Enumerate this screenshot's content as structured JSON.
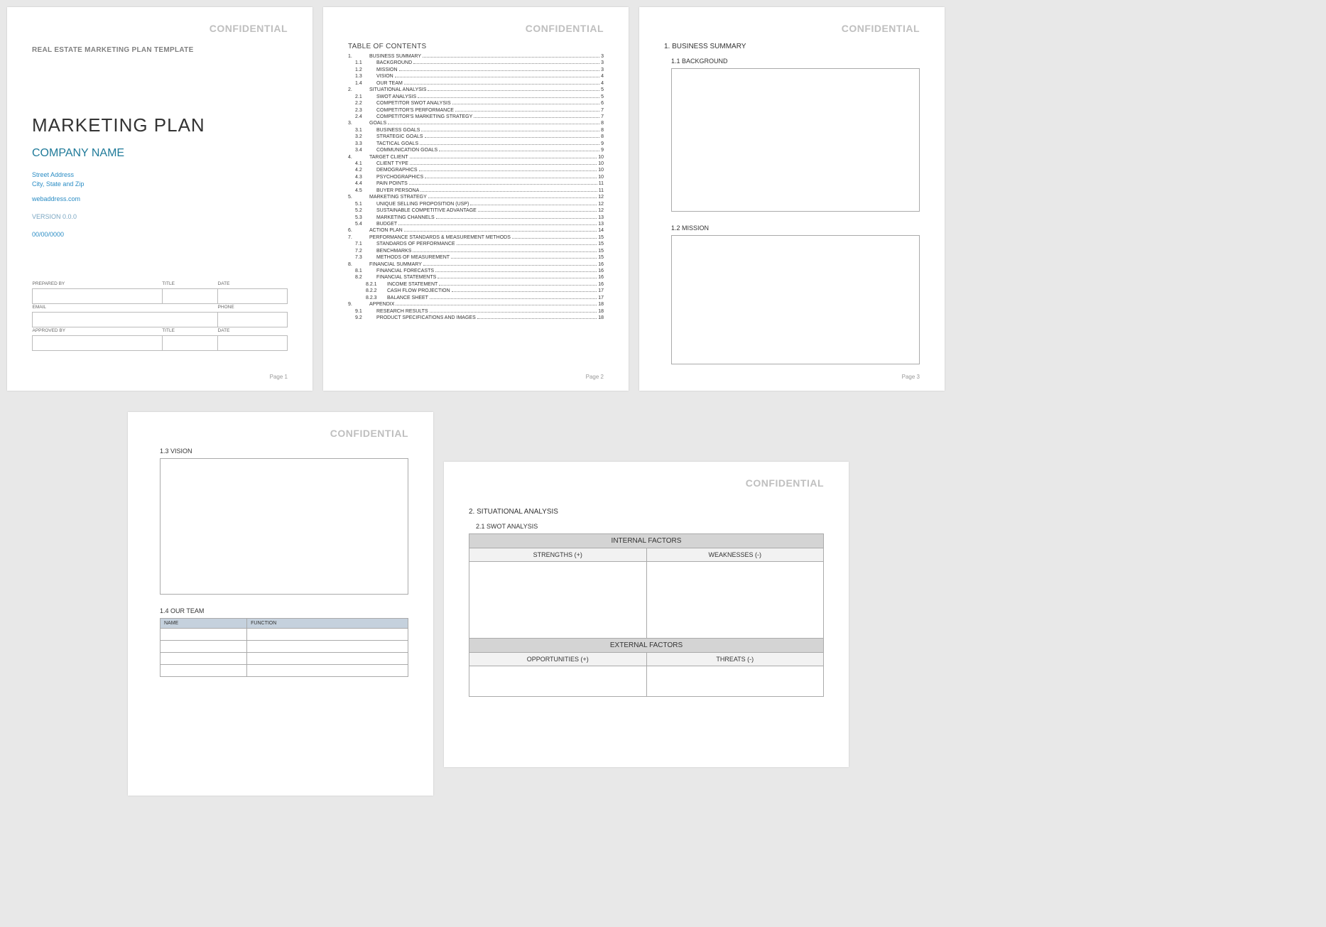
{
  "confidential": "CONFIDENTIAL",
  "page1": {
    "templateTitle": "REAL ESTATE MARKETING PLAN TEMPLATE",
    "title": "MARKETING PLAN",
    "company": "COMPANY NAME",
    "street": "Street Address",
    "cityState": "City, State and Zip",
    "web": "webaddress.com",
    "version": "VERSION 0.0.0",
    "date": "00/00/0000",
    "labels": {
      "preparedBy": "PREPARED BY",
      "title": "TITLE",
      "date": "DATE",
      "email": "EMAIL",
      "phone": "PHONE",
      "approvedBy": "APPROVED BY"
    },
    "pageNum": "Page 1"
  },
  "page2": {
    "tocHead": "TABLE OF CONTENTS",
    "toc": [
      {
        "n": "1.",
        "t": "BUSINESS SUMMARY",
        "p": "3",
        "lvl": 0
      },
      {
        "n": "1.1",
        "t": "BACKGROUND",
        "p": "3",
        "lvl": 1
      },
      {
        "n": "1.2",
        "t": "MISSION",
        "p": "3",
        "lvl": 1
      },
      {
        "n": "1.3",
        "t": "VISION",
        "p": "4",
        "lvl": 1
      },
      {
        "n": "1.4",
        "t": "OUR TEAM",
        "p": "4",
        "lvl": 1
      },
      {
        "n": "2.",
        "t": "SITUATIONAL ANALYSIS",
        "p": "5",
        "lvl": 0
      },
      {
        "n": "2.1",
        "t": "SWOT ANALYSIS",
        "p": "5",
        "lvl": 1
      },
      {
        "n": "2.2",
        "t": "COMPETITOR SWOT ANALYSIS",
        "p": "6",
        "lvl": 1
      },
      {
        "n": "2.3",
        "t": "COMPETITOR'S PERFORMANCE",
        "p": "7",
        "lvl": 1
      },
      {
        "n": "2.4",
        "t": "COMPETITOR'S MARKETING STRATEGY",
        "p": "7",
        "lvl": 1
      },
      {
        "n": "3.",
        "t": "GOALS",
        "p": "8",
        "lvl": 0
      },
      {
        "n": "3.1",
        "t": "BUSINESS GOALS",
        "p": "8",
        "lvl": 1
      },
      {
        "n": "3.2",
        "t": "STRATEGIC GOALS",
        "p": "8",
        "lvl": 1
      },
      {
        "n": "3.3",
        "t": "TACTICAL GOALS",
        "p": "9",
        "lvl": 1
      },
      {
        "n": "3.4",
        "t": "COMMUNICATION GOALS",
        "p": "9",
        "lvl": 1
      },
      {
        "n": "4.",
        "t": "TARGET CLIENT",
        "p": "10",
        "lvl": 0
      },
      {
        "n": "4.1",
        "t": "CLIENT TYPE",
        "p": "10",
        "lvl": 1
      },
      {
        "n": "4.2",
        "t": "DEMOGRAPHICS",
        "p": "10",
        "lvl": 1
      },
      {
        "n": "4.3",
        "t": "PSYCHOGRAPHICS",
        "p": "10",
        "lvl": 1
      },
      {
        "n": "4.4",
        "t": "PAIN POINTS",
        "p": "11",
        "lvl": 1
      },
      {
        "n": "4.5",
        "t": "BUYER PERSONA",
        "p": "11",
        "lvl": 1
      },
      {
        "n": "5.",
        "t": "MARKETING STRATEGY",
        "p": "12",
        "lvl": 0
      },
      {
        "n": "5.1",
        "t": "UNIQUE SELLING PROPOSITION (USP)",
        "p": "12",
        "lvl": 1
      },
      {
        "n": "5.2",
        "t": "SUSTAINABLE COMPETITIVE ADVANTAGE",
        "p": "12",
        "lvl": 1
      },
      {
        "n": "5.3",
        "t": "MARKETING CHANNELS",
        "p": "13",
        "lvl": 1
      },
      {
        "n": "5.4",
        "t": "BUDGET",
        "p": "13",
        "lvl": 1
      },
      {
        "n": "6.",
        "t": "ACTION PLAN",
        "p": "14",
        "lvl": 0
      },
      {
        "n": "7.",
        "t": "PERFORMANCE STANDARDS & MEASUREMENT METHODS",
        "p": "15",
        "lvl": 0
      },
      {
        "n": "7.1",
        "t": "STANDARDS OF PERFORMANCE",
        "p": "15",
        "lvl": 1
      },
      {
        "n": "7.2",
        "t": "BENCHMARKS",
        "p": "15",
        "lvl": 1
      },
      {
        "n": "7.3",
        "t": "METHODS OF MEASUREMENT",
        "p": "15",
        "lvl": 1
      },
      {
        "n": "8.",
        "t": "FINANCIAL SUMMARY",
        "p": "16",
        "lvl": 0
      },
      {
        "n": "8.1",
        "t": "FINANCIAL FORECASTS",
        "p": "16",
        "lvl": 1
      },
      {
        "n": "8.2",
        "t": "FINANCIAL STATEMENTS",
        "p": "16",
        "lvl": 1
      },
      {
        "n": "8.2.1",
        "t": "INCOME STATEMENT",
        "p": "16",
        "lvl": 2
      },
      {
        "n": "8.2.2",
        "t": "CASH FLOW PROJECTION",
        "p": "17",
        "lvl": 2
      },
      {
        "n": "8.2.3",
        "t": "BALANCE SHEET",
        "p": "17",
        "lvl": 2
      },
      {
        "n": "9.",
        "t": "APPENDIX",
        "p": "18",
        "lvl": 0
      },
      {
        "n": "9.1",
        "t": "RESEARCH RESULTS",
        "p": "18",
        "lvl": 1
      },
      {
        "n": "9.2",
        "t": "PRODUCT SPECIFICATIONS AND IMAGES",
        "p": "18",
        "lvl": 1
      }
    ],
    "pageNum": "Page 2"
  },
  "page3": {
    "sec": "1.  BUSINESS SUMMARY",
    "sub1": "1.1  BACKGROUND",
    "sub2": "1.2  MISSION",
    "pageNum": "Page 3"
  },
  "page4": {
    "sub1": "1.3  VISION",
    "sub2": "1.4  OUR TEAM",
    "teamCols": {
      "name": "NAME",
      "function": "FUNCTION"
    }
  },
  "page5": {
    "sec": "2.  SITUATIONAL ANALYSIS",
    "sub1": "2.1  SWOT ANALYSIS",
    "swot": {
      "internal": "INTERNAL FACTORS",
      "external": "EXTERNAL FACTORS",
      "strengths": "STRENGTHS (+)",
      "weaknesses": "WEAKNESSES (-)",
      "opportunities": "OPPORTUNITIES (+)",
      "threats": "THREATS (-)"
    }
  }
}
